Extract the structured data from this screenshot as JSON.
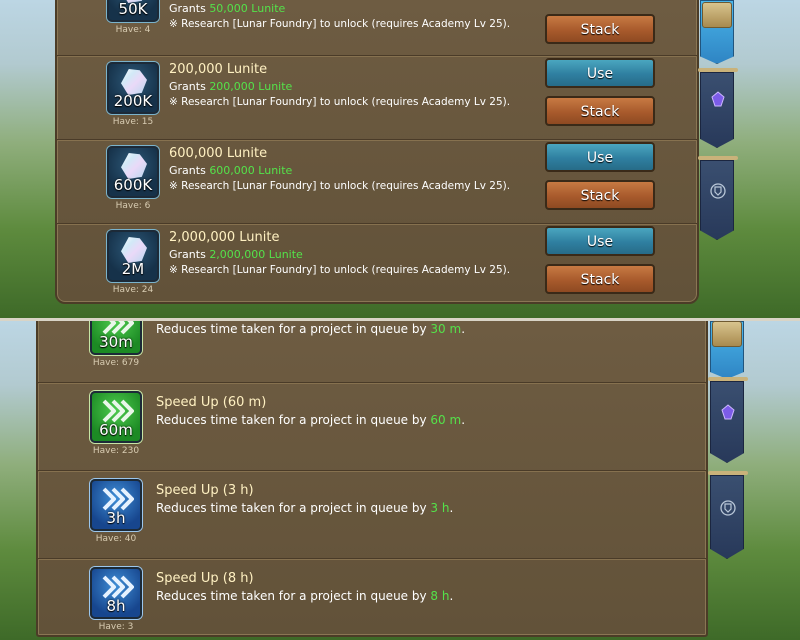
{
  "lunite_items": [
    {
      "icon_label": "50K",
      "have": "Have: 4",
      "grant_prefix": "Grants ",
      "grant_amount": "50,000 Lunite",
      "requirement": "※ Research [Lunar Foundry] to unlock (requires Academy Lv 25).",
      "stack_label": "Stack"
    },
    {
      "icon_label": "200K",
      "have": "Have: 15",
      "title": "200,000 Lunite",
      "grant_prefix": "Grants ",
      "grant_amount": "200,000 Lunite",
      "requirement": "※ Research [Lunar Foundry] to unlock (requires Academy Lv 25).",
      "use_label": "Use",
      "stack_label": "Stack"
    },
    {
      "icon_label": "600K",
      "have": "Have: 6",
      "title": "600,000 Lunite",
      "grant_prefix": "Grants ",
      "grant_amount": "600,000 Lunite",
      "requirement": "※ Research [Lunar Foundry] to unlock (requires Academy Lv 25).",
      "use_label": "Use",
      "stack_label": "Stack"
    },
    {
      "icon_label": "2M",
      "have": "Have: 24",
      "title": "2,000,000 Lunite",
      "grant_prefix": "Grants ",
      "grant_amount": "2,000,000 Lunite",
      "requirement": "※ Research [Lunar Foundry] to unlock (requires Academy Lv 25).",
      "use_label": "Use",
      "stack_label": "Stack"
    }
  ],
  "speedup_items": [
    {
      "icon_label": "30m",
      "have": "Have: 679",
      "desc_prefix": "Reduces time taken for a project in queue by ",
      "desc_amount": "30 m",
      "desc_suffix": "."
    },
    {
      "icon_label": "60m",
      "have": "Have: 230",
      "title": "Speed Up (60 m)",
      "desc_prefix": "Reduces time taken for a project in queue by ",
      "desc_amount": "60 m",
      "desc_suffix": "."
    },
    {
      "icon_label": "3h",
      "have": "Have: 40",
      "title": "Speed Up (3 h)",
      "desc_prefix": "Reduces time taken for a project in queue by ",
      "desc_amount": "3 h",
      "desc_suffix": "."
    },
    {
      "icon_label": "8h",
      "have": "Have: 3",
      "title": "Speed Up (8 h)",
      "desc_prefix": "Reduces time taken for a project in queue by ",
      "desc_amount": "8 h",
      "desc_suffix": "."
    }
  ],
  "side_tabs": [
    "crate-icon",
    "crystal-icon",
    "shield-icon"
  ],
  "colors": {
    "highlight": "#54e24a",
    "use_button": "#2f7fa0",
    "stack_button": "#a85a2c",
    "panel": "#6e5c42"
  }
}
